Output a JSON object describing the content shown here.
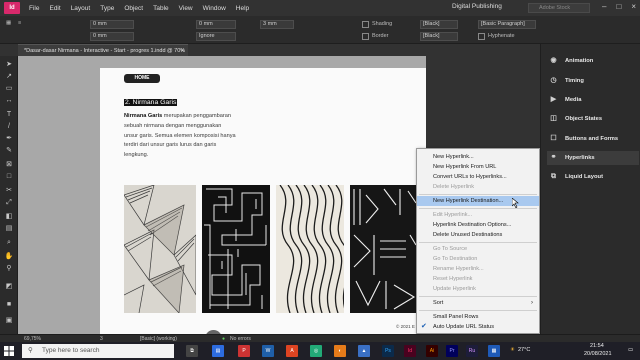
{
  "menubar": {
    "logo": "Id",
    "items": [
      "File",
      "Edit",
      "Layout",
      "Type",
      "Object",
      "Table",
      "View",
      "Window",
      "Help"
    ],
    "workspace": "Digital Publishing",
    "stock_placeholder": "Adobe Stock"
  },
  "control": {
    "x_value": "0 mm",
    "y_value": "0 mm",
    "ignore_label": "Ignore",
    "gutter_value": "3 mm",
    "shading_label": "Shading",
    "border_label": "Border",
    "swatch_label": "[Black]",
    "para_style": "[Basic Paragraph]",
    "hyphenate_label": "Hyphenate"
  },
  "doc_tab": {
    "title": "*Dasar-dasar Nirmana - Interactive - Start - progres 1.indd @ 70%",
    "close": "×"
  },
  "page": {
    "home_label": "HOME",
    "heading": "2. Nirmana Garis",
    "body_bold": "Nirmana Garis",
    "body_line1": " merupakan",
    "body_rest": "penggambaran sebuah nirmana  dengan menggunakan unsur garis. Semua elemen komposisi hanya terdiri dari unsur garis lurus dan garis lengkung.",
    "footer": "© 2021 E",
    "page_number": "3"
  },
  "context_menu": {
    "items": [
      {
        "label": "New Hyperlink...",
        "enabled": true
      },
      {
        "label": "New Hyperlink From URL",
        "enabled": true
      },
      {
        "label": "Convert URLs to Hyperlinks...",
        "enabled": true
      },
      {
        "label": "Delete Hyperlink",
        "enabled": false
      },
      {
        "label": "New Hyperlink Destination...",
        "enabled": true,
        "highlighted": true
      },
      {
        "label": "Edit Hyperlink...",
        "enabled": false
      },
      {
        "label": "Hyperlink Destination Options...",
        "enabled": true
      },
      {
        "label": "Delete Unused Destinations",
        "enabled": true
      },
      {
        "label": "Go To Source",
        "enabled": false
      },
      {
        "label": "Go To Destination",
        "enabled": false
      },
      {
        "label": "Rename Hyperlink...",
        "enabled": false
      },
      {
        "label": "Reset Hyperlink",
        "enabled": false
      },
      {
        "label": "Update Hyperlink",
        "enabled": false
      },
      {
        "label": "Sort",
        "enabled": true,
        "submenu": true
      },
      {
        "label": "Small Panel Rows",
        "enabled": true
      },
      {
        "label": "Auto Update URL Status",
        "enabled": true,
        "checked": true
      }
    ]
  },
  "panels": {
    "items": [
      {
        "label": "Animation",
        "icon": "animation-icon"
      },
      {
        "label": "Timing",
        "icon": "timing-icon"
      },
      {
        "label": "Media",
        "icon": "media-icon"
      },
      {
        "label": "Object States",
        "icon": "object-states-icon"
      },
      {
        "label": "Buttons and Forms",
        "icon": "buttons-forms-icon"
      },
      {
        "label": "Hyperlinks",
        "icon": "hyperlinks-icon",
        "active": true
      },
      {
        "label": "Liquid Layout",
        "icon": "liquid-layout-icon"
      }
    ]
  },
  "status": {
    "zoom": "69,75%",
    "page_field": "3",
    "style": "[Basic] (working)",
    "errors": "No errors"
  },
  "taskbar": {
    "search_placeholder": "Type here to search",
    "temp": "27°C",
    "time": "21:54",
    "date": "20/08/2021"
  },
  "colors": {
    "accent": "#d8296b",
    "menu_highlight": "#a9c9ef",
    "panel_bg": "#2b2b2b"
  }
}
